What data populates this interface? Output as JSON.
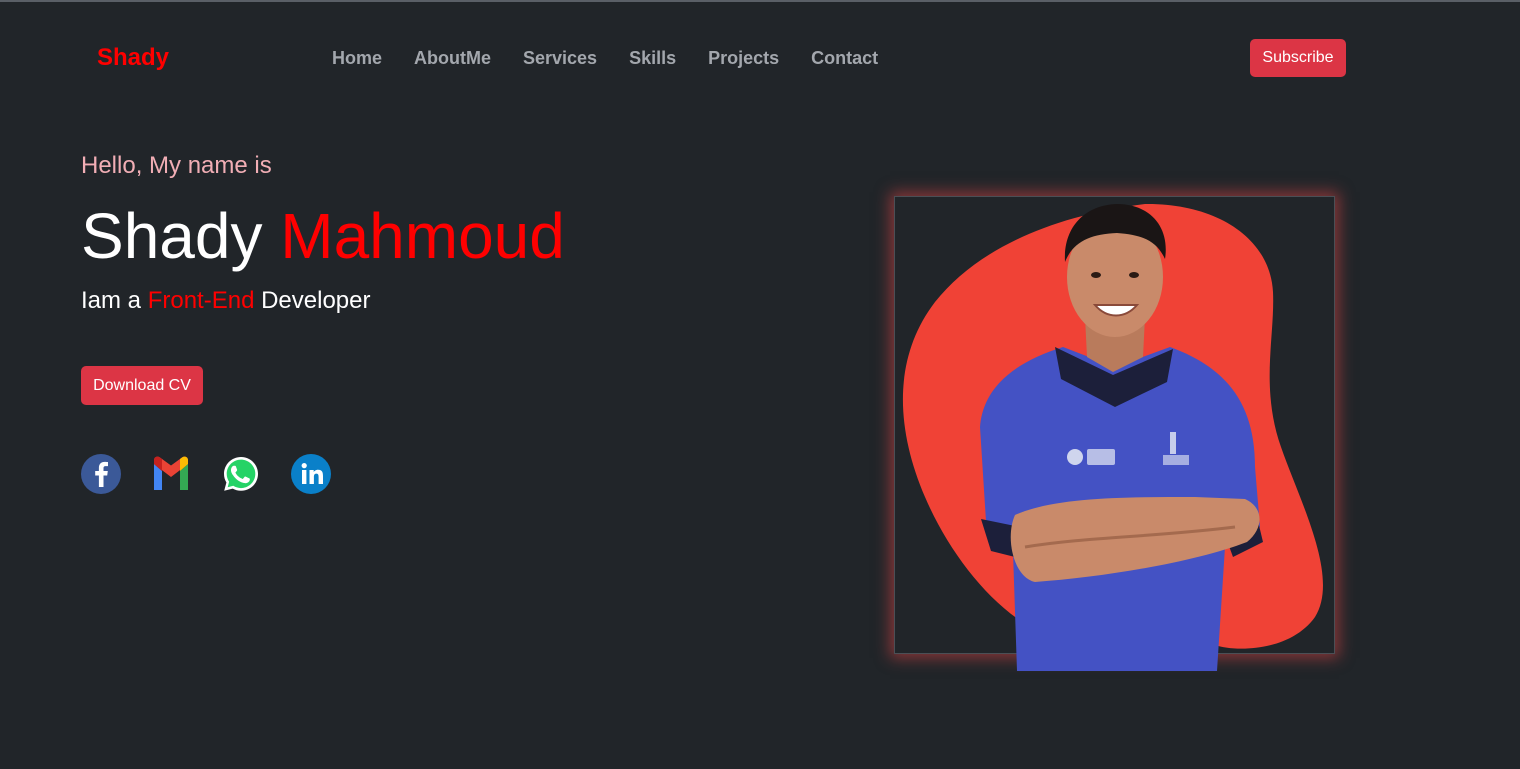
{
  "brand": "Shady",
  "nav": {
    "items": [
      {
        "label": "Home"
      },
      {
        "label": "AboutMe"
      },
      {
        "label": "Services"
      },
      {
        "label": "Skills"
      },
      {
        "label": "Projects"
      },
      {
        "label": "Contact"
      }
    ],
    "subscribe_label": "Subscribe"
  },
  "hero": {
    "greeting": "Hello, My name is",
    "first_name": "Shady",
    "last_name": "Mahmoud",
    "role_prefix": "Iam a",
    "role_accent": "Front-End",
    "role_suffix": "Developer",
    "download_label": "Download CV"
  },
  "social": [
    {
      "icon": "facebook-icon"
    },
    {
      "icon": "gmail-icon"
    },
    {
      "icon": "whatsapp-icon"
    },
    {
      "icon": "linkedin-icon"
    }
  ],
  "colors": {
    "background": "#212529",
    "accent": "#ff0000",
    "button": "#dc3545",
    "blob": "#f04236",
    "shirt": "#4452c4"
  }
}
